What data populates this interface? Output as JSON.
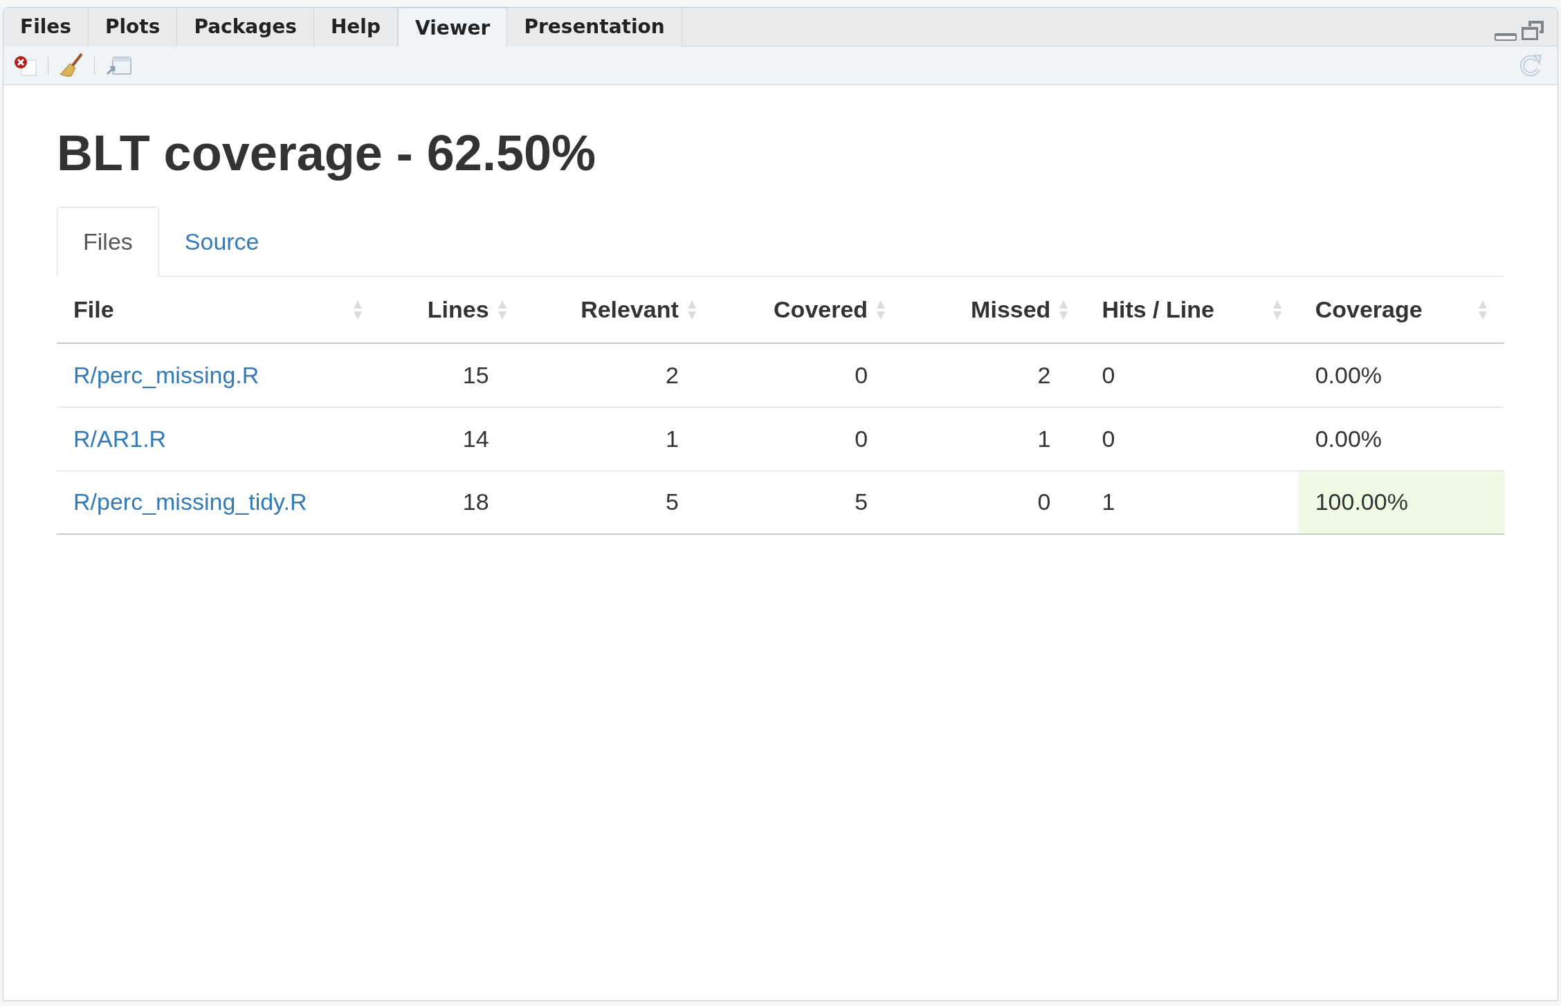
{
  "pane_tabs": [
    {
      "label": "Files",
      "selected": false
    },
    {
      "label": "Plots",
      "selected": false
    },
    {
      "label": "Packages",
      "selected": false
    },
    {
      "label": "Help",
      "selected": false
    },
    {
      "label": "Viewer",
      "selected": true
    },
    {
      "label": "Presentation",
      "selected": false
    }
  ],
  "report": {
    "title": "BLT coverage - 62.50%",
    "tabs": [
      {
        "label": "Files",
        "selected": true
      },
      {
        "label": "Source",
        "selected": false
      }
    ],
    "table": {
      "columns": [
        "File",
        "Lines",
        "Relevant",
        "Covered",
        "Missed",
        "Hits / Line",
        "Coverage"
      ],
      "rows": [
        {
          "cells": [
            "R/perc_missing.R",
            "15",
            "2",
            "0",
            "2",
            "0",
            "0.00%"
          ]
        },
        {
          "cells": [
            "R/AR1.R",
            "14",
            "1",
            "0",
            "1",
            "0",
            "0.00%"
          ]
        },
        {
          "cells": [
            "R/perc_missing_tidy.R",
            "18",
            "5",
            "5",
            "0",
            "1",
            "100.00%"
          ],
          "color": "#edfbe4"
        }
      ]
    }
  }
}
